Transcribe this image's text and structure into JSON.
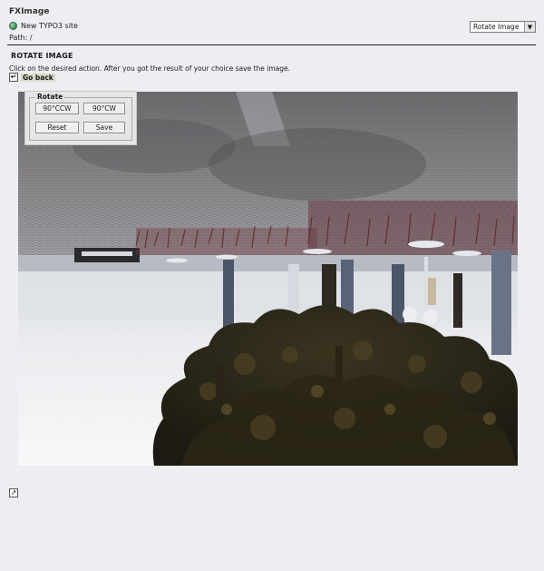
{
  "app": {
    "title": "FXImage"
  },
  "site": {
    "icon": "globe-icon",
    "name": "New TYPO3 site",
    "path": "Path: /"
  },
  "function_menu": {
    "selected": "Rotate Image",
    "icon": "chevron-down-icon"
  },
  "section": {
    "title": "ROTATE IMAGE",
    "instruction": "Click on the desired action. After you got the result of your choice save the image.",
    "go_back": {
      "icon": "back-arrow-icon",
      "label": "Go back"
    }
  },
  "rotate_panel": {
    "legend": "Rotate",
    "ccw_label": "90°CCW",
    "cw_label": "90°CW",
    "reset_label": "Reset",
    "save_label": "Save"
  },
  "footer": {
    "icon": "external-link-icon"
  },
  "colors": {
    "background": "#eeeef2",
    "divider": "#222222",
    "go_back_bg": "#d9d9c9"
  }
}
